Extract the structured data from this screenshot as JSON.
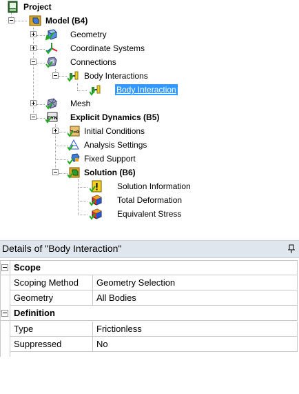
{
  "tree": {
    "project": "Project",
    "model": "Model (B4)",
    "geometry": "Geometry",
    "coordinate_systems": "Coordinate Systems",
    "connections": "Connections",
    "body_interactions": "Body Interactions",
    "body_interaction": "Body Interaction",
    "mesh": "Mesh",
    "explicit_dynamics": "Explicit Dynamics (B5)",
    "initial_conditions": "Initial Conditions",
    "analysis_settings": "Analysis Settings",
    "fixed_support": "Fixed Support",
    "solution": "Solution (B6)",
    "solution_information": "Solution Information",
    "total_deformation": "Total Deformation",
    "equivalent_stress": "Equivalent Stress",
    "dyn_badge": "DYN",
    "t0_badge": "T=0"
  },
  "details": {
    "title": "Details of \"Body Interaction\"",
    "sections": [
      {
        "name": "Scope",
        "rows": [
          {
            "name": "Scoping Method",
            "value": "Geometry Selection"
          },
          {
            "name": "Geometry",
            "value": "All Bodies"
          }
        ]
      },
      {
        "name": "Definition",
        "rows": [
          {
            "name": "Type",
            "value": "Frictionless"
          },
          {
            "name": "Suppressed",
            "value": "No"
          }
        ]
      }
    ]
  },
  "colors": {
    "selection": "#3399ff",
    "header_bg": "#dfe6ee",
    "check": "#22aa22"
  }
}
